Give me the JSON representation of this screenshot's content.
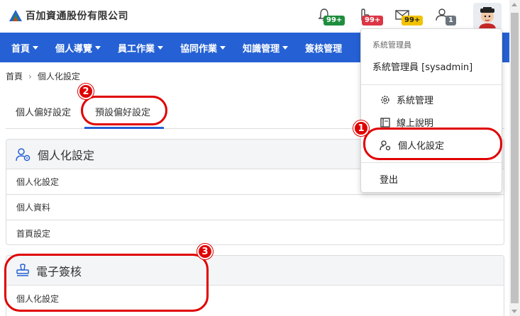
{
  "header": {
    "company_name": "百加資通股份有限公司",
    "notifications": [
      {
        "icon": "bell-icon",
        "badge": "99+",
        "color": "#1e8e3e"
      },
      {
        "icon": "hand-icon",
        "badge": "99+",
        "color": "#dc3545"
      },
      {
        "icon": "mail-icon",
        "badge": "99+",
        "color": "#f2c200"
      },
      {
        "icon": "user-icon",
        "badge": "1",
        "color": "#6c757d"
      }
    ],
    "avatar_icon": "avatar-icon"
  },
  "nav": {
    "items": [
      "首頁",
      "個人導覽",
      "員工作業",
      "協同作業",
      "知識管理",
      "簽核管理"
    ]
  },
  "breadcrumb": {
    "home": "首頁",
    "current": "個人化設定"
  },
  "tabs": [
    {
      "label": "個人偏好設定"
    },
    {
      "label": "預設偏好設定"
    }
  ],
  "cards": [
    {
      "title": "個人化設定",
      "icon": "user-settings-icon",
      "rows": [
        "個人化設定",
        "個人資料",
        "首頁設定"
      ]
    },
    {
      "title": "電子簽核",
      "icon": "stamp-icon",
      "rows": [
        "個人化設定"
      ]
    }
  ],
  "dropdown": {
    "header": "系統管理員",
    "user": "系統管理員 [sysadmin]",
    "items": [
      {
        "label": "系統管理",
        "icon": "gear-icon"
      },
      {
        "label": "線上說明",
        "icon": "book-icon"
      },
      {
        "label": "個人化設定",
        "icon": "user-settings-icon"
      }
    ],
    "logout": "登出"
  },
  "annotations": [
    "1",
    "2",
    "3"
  ],
  "colors": {
    "nav_bg": "#2561d4",
    "annotation_red": "#e00000"
  }
}
